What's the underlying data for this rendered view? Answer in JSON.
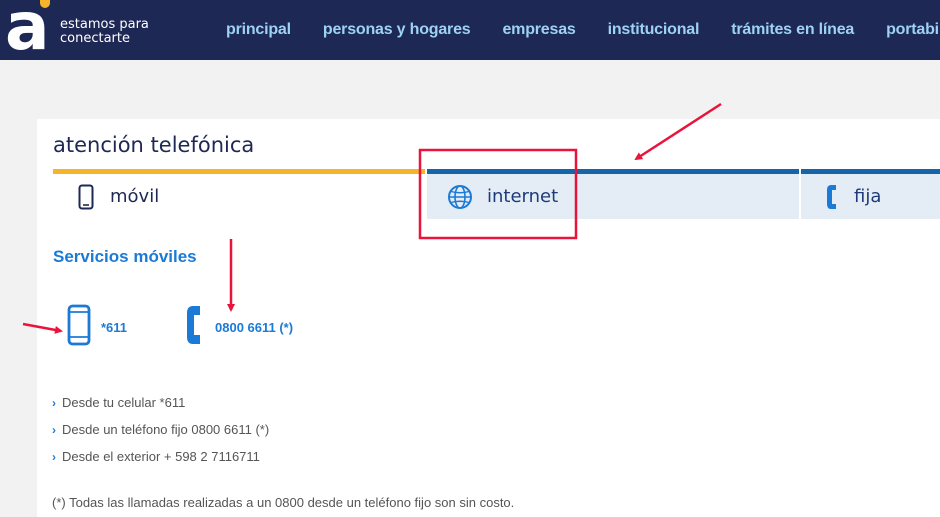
{
  "header": {
    "logo_letter": "a",
    "tagline_line1": "estamos para",
    "tagline_line2": "conectarte",
    "nav": [
      "principal",
      "personas y hogares",
      "empresas",
      "institucional",
      "trámites en línea",
      "portabilidad"
    ]
  },
  "panel": {
    "title": "atención telefónica",
    "tabs": [
      {
        "label": "móvil",
        "icon": "smartphone-icon",
        "active": true
      },
      {
        "label": "internet",
        "icon": "globe-icon",
        "active": false
      },
      {
        "label": "fija",
        "icon": "phone-handset-icon",
        "active": false
      }
    ],
    "section_title": "Servicios móviles",
    "contacts": [
      {
        "label": "*611",
        "icon": "smartphone-icon"
      },
      {
        "label": "0800 6611 (*)",
        "icon": "phone-handset-icon"
      }
    ],
    "list": [
      "Desde tu celular *611",
      "Desde un teléfono fijo 0800 6611 (*)",
      "Desde el exterior + 598 2 7116711"
    ],
    "note": "(*) Todas las llamadas realizadas a un 0800 desde un teléfono fijo son sin costo."
  },
  "colors": {
    "header_bg": "#1e2854",
    "nav_text": "#9dd1f5",
    "accent_yellow": "#f5b52a",
    "accent_blue": "#1565a9",
    "link_blue": "#1b7ad6",
    "annotation_red": "#e8143c"
  }
}
